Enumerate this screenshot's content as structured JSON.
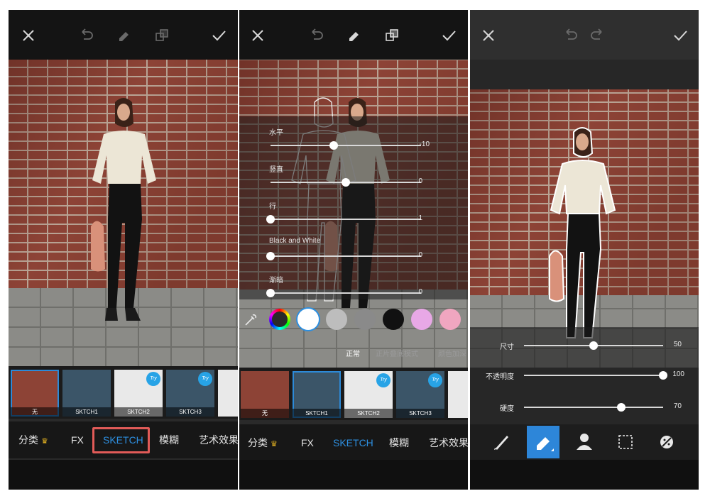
{
  "panel1": {
    "thumbnails": [
      {
        "label": "无"
      },
      {
        "label": "SKTCH1"
      },
      {
        "label": "SKTCH2",
        "badge": "Try"
      },
      {
        "label": "SKTCH3",
        "badge": "Try"
      }
    ],
    "categories": [
      {
        "label": "分类",
        "crown": "♛"
      },
      {
        "label": "FX"
      },
      {
        "label": "SKETCH",
        "active": true
      },
      {
        "label": "模糊"
      },
      {
        "label": "艺术效果"
      }
    ]
  },
  "panel2": {
    "sliders": [
      {
        "label": "水平",
        "value": "-10",
        "fraction": 0.42
      },
      {
        "label": "竖直",
        "value": "0",
        "fraction": 0.5
      },
      {
        "label": "行",
        "value": "1",
        "fraction": 0.0
      },
      {
        "label": "Black and White",
        "value": "0",
        "fraction": 0.0
      },
      {
        "label": "渐暗",
        "value": "0",
        "fraction": 0.0
      }
    ],
    "swatch_colors": [
      "#ffffff",
      "#bdbdbd",
      "#8a8a8a",
      "#111111",
      "#e8a8e6",
      "#f0a6c0"
    ],
    "blend_modes": [
      {
        "label": "正常",
        "selected": true
      },
      {
        "label": "正片叠底模式"
      },
      {
        "label": "颜色加深"
      }
    ],
    "thumbnails": [
      {
        "label": "无"
      },
      {
        "label": "SKTCH1"
      },
      {
        "label": "SKTCH2",
        "badge": "Try"
      },
      {
        "label": "SKTCH3",
        "badge": "Try"
      }
    ],
    "categories": [
      {
        "label": "分类",
        "crown": "♛"
      },
      {
        "label": "FX"
      },
      {
        "label": "SKETCH",
        "active": true
      },
      {
        "label": "模糊"
      },
      {
        "label": "艺术效果"
      }
    ]
  },
  "panel3": {
    "sliders": [
      {
        "label": "尺寸",
        "value": "50",
        "fraction": 0.5
      },
      {
        "label": "不透明度",
        "value": "100",
        "fraction": 1.0
      },
      {
        "label": "硬度",
        "value": "70",
        "fraction": 0.7
      }
    ],
    "tools": [
      "brush-icon",
      "eraser-icon",
      "person-icon",
      "selection-icon",
      "invert-icon"
    ]
  },
  "colors": {
    "accent": "#2d8fe0",
    "highlight": "#e25b58",
    "try_badge": "#27a3e6"
  }
}
